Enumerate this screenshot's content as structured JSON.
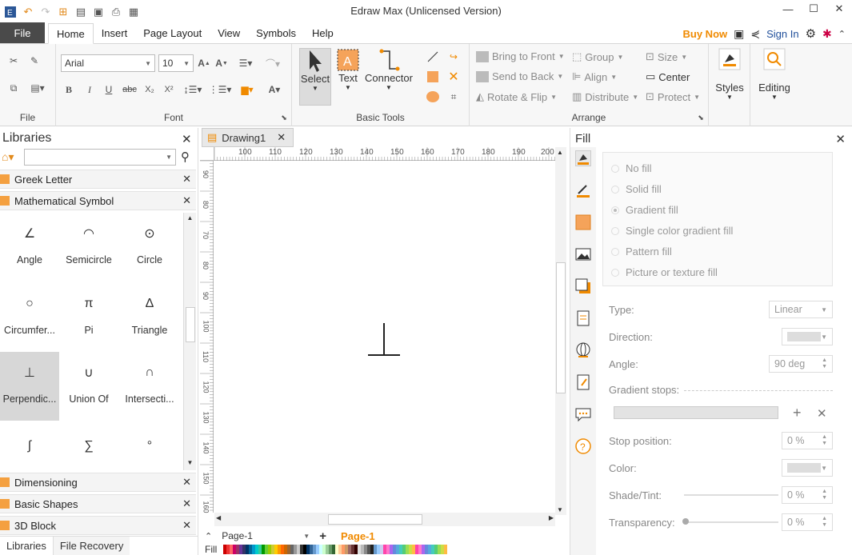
{
  "app": {
    "title": "Edraw Max (Unlicensed Version)"
  },
  "menu": {
    "file": "File",
    "items": [
      "Home",
      "Insert",
      "Page Layout",
      "View",
      "Symbols",
      "Help"
    ],
    "buy_now": "Buy Now",
    "sign_in": "Sign In"
  },
  "ribbon": {
    "file_group": "File",
    "font_group": "Font",
    "font_name": "Arial",
    "font_size": "10",
    "basic_tools_group": "Basic Tools",
    "select": "Select",
    "text": "Text",
    "connector": "Connector",
    "arrange_group": "Arrange",
    "bring_to_front": "Bring to Front",
    "send_to_back": "Send to Back",
    "rotate_flip": "Rotate & Flip",
    "group": "Group",
    "align": "Align",
    "distribute": "Distribute",
    "size": "Size",
    "center": "Center",
    "protect": "Protect",
    "styles": "Styles",
    "editing": "Editing"
  },
  "libraries": {
    "title": "Libraries",
    "groups": [
      "Greek Letter",
      "Mathematical Symbol"
    ],
    "symbols": [
      {
        "glyph": "∠",
        "label": "Angle"
      },
      {
        "glyph": "◠",
        "label": "Semicircle"
      },
      {
        "glyph": "⊙",
        "label": "Circle"
      },
      {
        "glyph": "○",
        "label": "Circumfer..."
      },
      {
        "glyph": "π",
        "label": "Pi"
      },
      {
        "glyph": "Δ",
        "label": "Triangle"
      },
      {
        "glyph": "⊥",
        "label": "Perpendic..."
      },
      {
        "glyph": "∪",
        "label": "Union Of"
      },
      {
        "glyph": "∩",
        "label": "Intersecti..."
      },
      {
        "glyph": "∫",
        "label": ""
      },
      {
        "glyph": "∑",
        "label": ""
      },
      {
        "glyph": "°",
        "label": ""
      }
    ],
    "bottom_groups": [
      "Dimensioning",
      "Basic Shapes",
      "3D Block"
    ],
    "tabs": [
      "Libraries",
      "File Recovery"
    ]
  },
  "document": {
    "tab": "Drawing1",
    "ruler_h": [
      "100",
      "110",
      "120",
      "130",
      "140",
      "150",
      "160",
      "170",
      "180",
      "190",
      "200"
    ],
    "ruler_v": [
      "90",
      "80",
      "70",
      "80",
      "90",
      "100",
      "110",
      "120",
      "130",
      "140",
      "150",
      "160"
    ],
    "page_select": "Page-1",
    "page_tab": "Page-1",
    "fill_label": "Fill"
  },
  "fill_panel": {
    "title": "Fill",
    "options": [
      "No fill",
      "Solid fill",
      "Gradient fill",
      "Single color gradient fill",
      "Pattern fill",
      "Picture or texture fill"
    ],
    "type_label": "Type:",
    "type_value": "Linear",
    "direction_label": "Direction:",
    "angle_label": "Angle:",
    "angle_value": "90 deg",
    "gradient_stops_label": "Gradient stops:",
    "stop_position_label": "Stop position:",
    "stop_position_value": "0 %",
    "color_label": "Color:",
    "shade_label": "Shade/Tint:",
    "shade_value": "0 %",
    "transparency_label": "Transparency:",
    "transparency_value": "0 %"
  },
  "colors": {
    "accent": "#f08a00",
    "file_bg": "#4a4a4a",
    "selected_tile": "#d7d7d7"
  }
}
